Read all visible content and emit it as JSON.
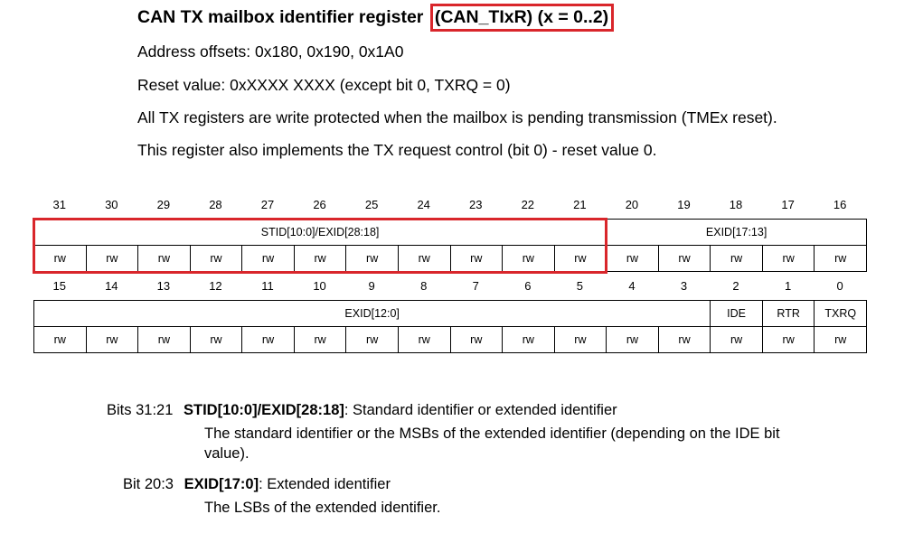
{
  "title": {
    "main": "CAN TX mailbox identifier register ",
    "highlight": "(CAN_TIxR) (x = 0..2)"
  },
  "paragraphs": [
    "Address offsets: 0x180, 0x190, 0x1A0",
    "Reset value: 0xXXXX XXXX (except bit 0, TXRQ = 0)",
    "All TX registers are write protected when the mailbox is pending transmission (TMEx reset).",
    "This register also implements the TX request control (bit 0) - reset value 0."
  ],
  "upper": {
    "bits": [
      "31",
      "30",
      "29",
      "28",
      "27",
      "26",
      "25",
      "24",
      "23",
      "22",
      "21",
      "20",
      "19",
      "18",
      "17",
      "16"
    ],
    "fields": [
      {
        "name": "STID[10:0]/EXID[28:18]",
        "span": 11
      },
      {
        "name": "EXID[17:13]",
        "span": 5
      }
    ],
    "access": [
      "rw",
      "rw",
      "rw",
      "rw",
      "rw",
      "rw",
      "rw",
      "rw",
      "rw",
      "rw",
      "rw",
      "rw",
      "rw",
      "rw",
      "rw",
      "rw"
    ]
  },
  "lower": {
    "bits": [
      "15",
      "14",
      "13",
      "12",
      "11",
      "10",
      "9",
      "8",
      "7",
      "6",
      "5",
      "4",
      "3",
      "2",
      "1",
      "0"
    ],
    "fields": [
      {
        "name": "EXID[12:0]",
        "span": 13
      },
      {
        "name": "IDE",
        "span": 1
      },
      {
        "name": "RTR",
        "span": 1
      },
      {
        "name": "TXRQ",
        "span": 1
      }
    ],
    "access": [
      "rw",
      "rw",
      "rw",
      "rw",
      "rw",
      "rw",
      "rw",
      "rw",
      "rw",
      "rw",
      "rw",
      "rw",
      "rw",
      "rw",
      "rw",
      "rw"
    ]
  },
  "descriptions": [
    {
      "bits": "Bits 31:21",
      "field": "STID[10:0]/EXID[28:18]",
      "summary": ": Standard identifier or extended identifier",
      "detail_line1": "The standard identifier or the MSBs of the extended identifier (depending on the IDE bit",
      "detail_line2": "value)."
    },
    {
      "bits": "Bit 20:3",
      "field": "EXID[17:0]",
      "summary": ": Extended identifier",
      "detail_line1": "The LSBs of the extended identifier."
    }
  ]
}
